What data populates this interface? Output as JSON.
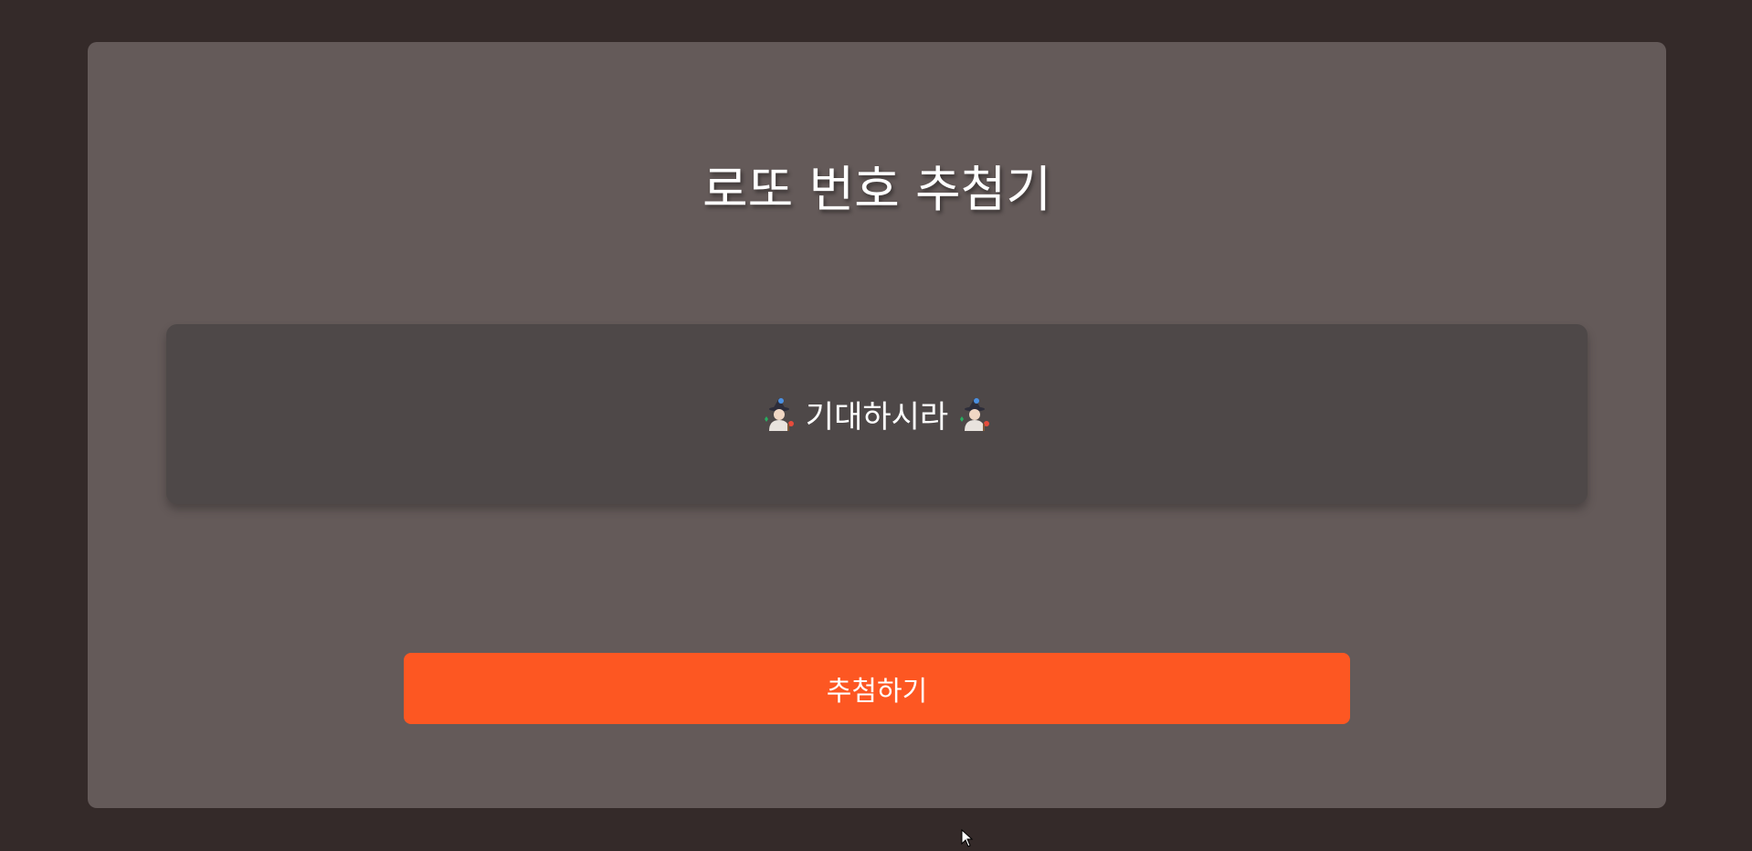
{
  "app": {
    "title": "로또 번호 추첨기"
  },
  "result": {
    "message": "기대하시라",
    "left_icon": "mage-icon",
    "right_icon": "mage-icon"
  },
  "actions": {
    "draw_label": "추첨하기"
  },
  "colors": {
    "page_background": "#342a29",
    "card_background": "#645a59",
    "result_background": "#4e4848",
    "accent": "#fd5722",
    "text": "#ffffff"
  }
}
